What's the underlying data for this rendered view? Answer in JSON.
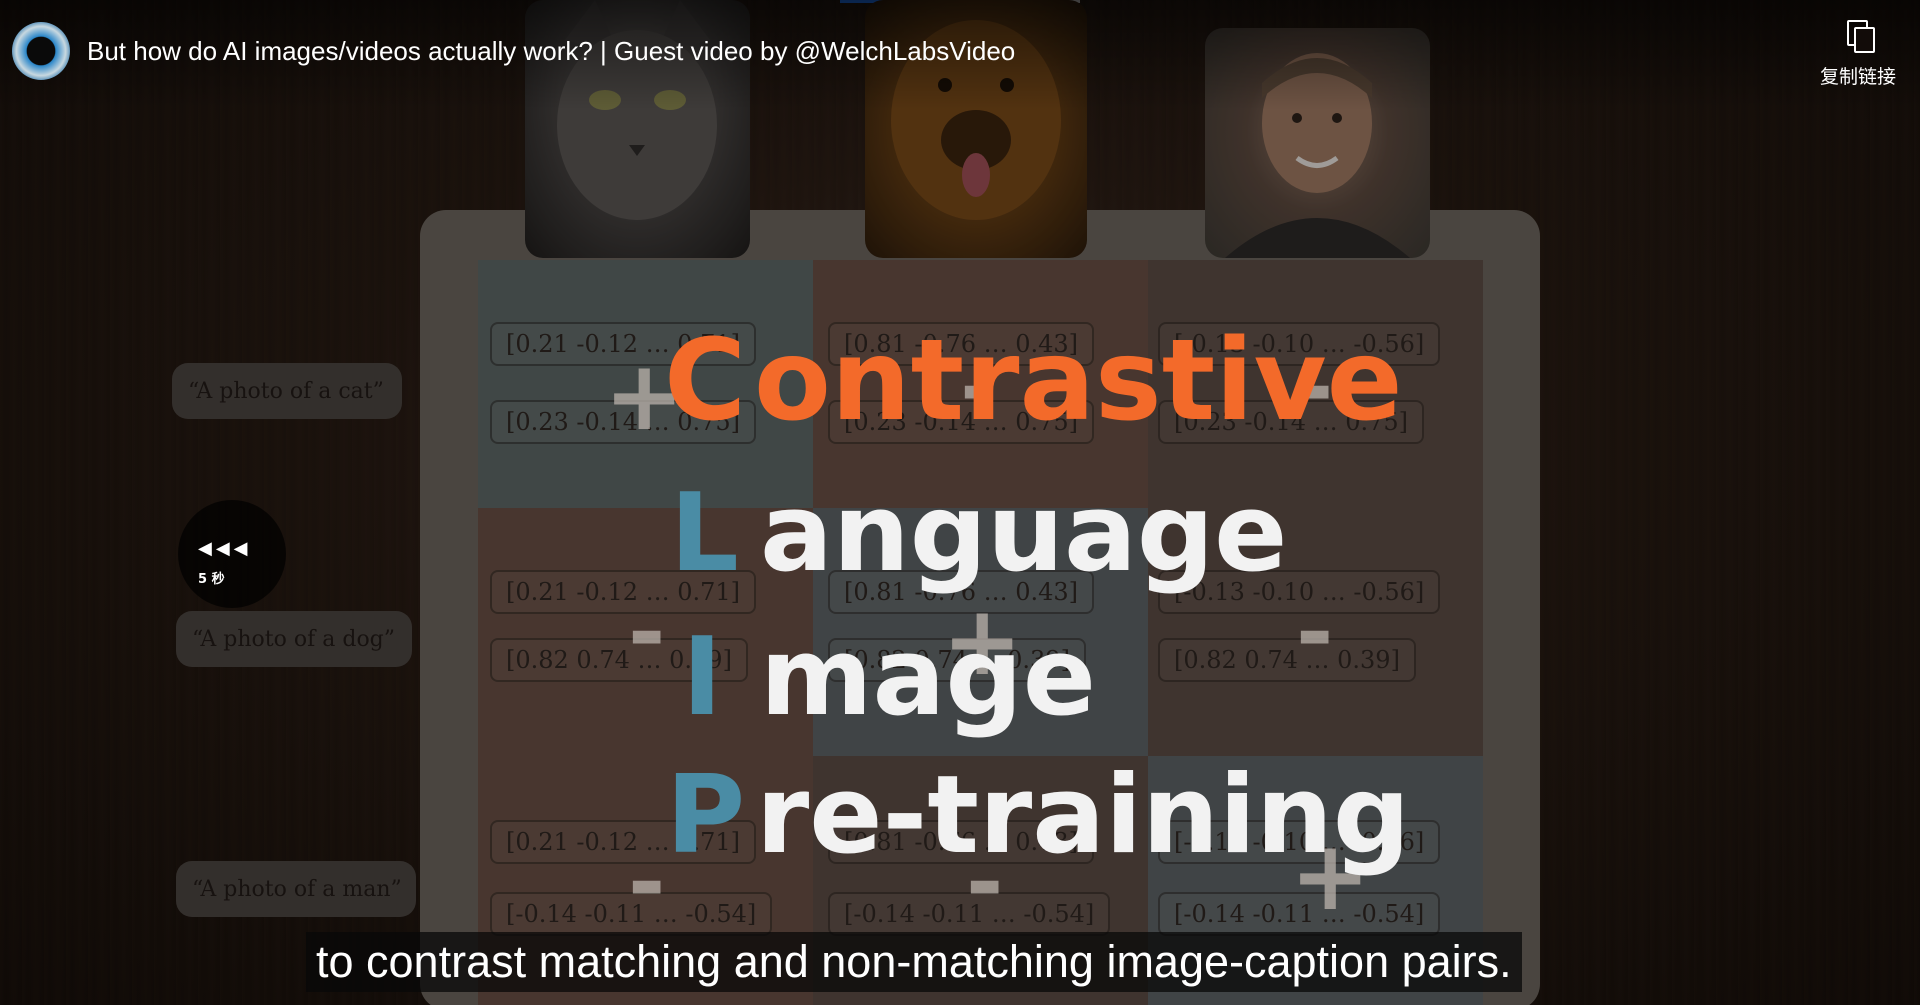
{
  "player": {
    "video_title": "But how do AI images/videos actually work? | Guest video by @WelchLabsVideo",
    "copy_link_label": "复制链接",
    "seek_back_label": "5 秒",
    "subtitle": "to contrast matching and non-matching image-caption pairs.",
    "progress_fraction": 0.2,
    "accent_color": "#1e78ff"
  },
  "captions": [
    "“A photo of a cat”",
    "“A photo of a dog”",
    "“A photo of a man”"
  ],
  "image_vectors": [
    "[0.21  -0.12  …  0.71]",
    "[0.81  -0.76  …  0.43]",
    "[-0.13  -0.10  …  -0.56]"
  ],
  "text_vectors": [
    "[0.23  -0.14  …  0.75]",
    "[0.82  0.74  …  0.39]",
    "[-0.14  -0.11  …  -0.54]"
  ],
  "clip": {
    "row1_first": "C",
    "row1_rest": "ontrastive",
    "row2_first": "L",
    "row2_rest": "anguage",
    "row3_first": "I",
    "row3_rest": "mage",
    "row4_first": "P",
    "row4_rest": "re-training",
    "orange": "#f36a2a",
    "teal": "#4a8ca5"
  },
  "signs": {
    "plus": "+",
    "minus": "-"
  }
}
